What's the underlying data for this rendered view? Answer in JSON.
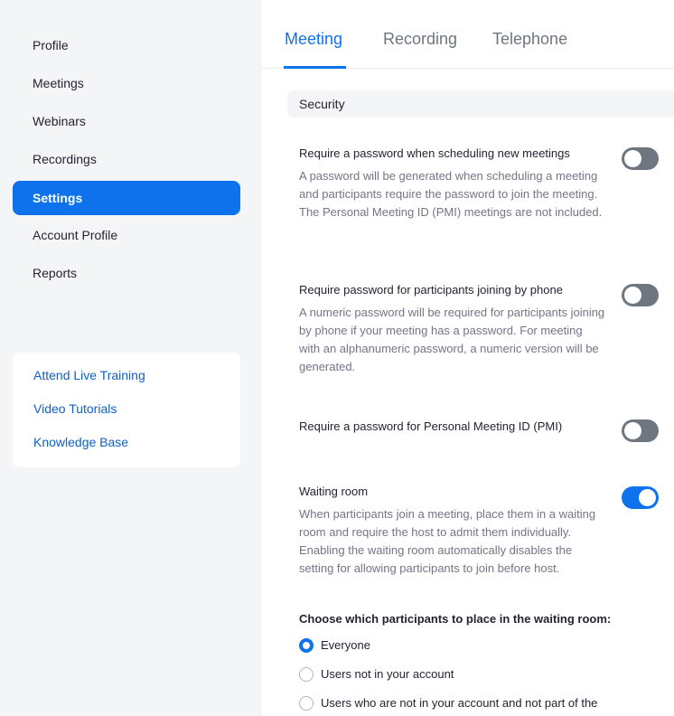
{
  "sidebar": {
    "items": [
      {
        "label": "Profile"
      },
      {
        "label": "Meetings"
      },
      {
        "label": "Webinars"
      },
      {
        "label": "Recordings"
      },
      {
        "label": "Settings",
        "active": true
      },
      {
        "label": "Account Profile"
      },
      {
        "label": "Reports"
      }
    ],
    "help_links": [
      {
        "label": "Attend Live Training"
      },
      {
        "label": "Video Tutorials"
      },
      {
        "label": "Knowledge Base"
      }
    ]
  },
  "tabs": [
    {
      "label": "Meeting",
      "active": true
    },
    {
      "label": "Recording"
    },
    {
      "label": "Telephone"
    }
  ],
  "section": {
    "title": "Security"
  },
  "settings": [
    {
      "title": "Require a password when scheduling new meetings",
      "description": "A password will be generated when scheduling a meeting and participants require the password to join the meeting. The Personal Meeting ID (PMI) meetings are not included.",
      "enabled": false
    },
    {
      "title": "Require password for participants joining by phone",
      "description": "A numeric password will be required for participants joining by phone if your meeting has a password. For meeting with an alphanumeric password, a numeric version will be generated.",
      "enabled": false
    },
    {
      "title": "Require a password for Personal Meeting ID (PMI)",
      "description": "",
      "enabled": false
    },
    {
      "title": "Waiting room",
      "description": "When participants join a meeting, place them in a waiting room and require the host to admit them individually. Enabling the waiting room automatically disables the setting for allowing participants to join before host.",
      "enabled": true
    }
  ],
  "waiting_room": {
    "question": "Choose which participants to place in the waiting room:",
    "options": [
      {
        "label": "Everyone",
        "selected": true
      },
      {
        "label": "Users not in your account",
        "selected": false
      },
      {
        "label": "Users who are not in your account and not part of the",
        "selected": false
      }
    ]
  },
  "colors": {
    "accent": "#0e72ed",
    "sidebar_bg": "#f4f5f7",
    "toggle_off": "#6e7680",
    "link": "#0e5fc6"
  }
}
